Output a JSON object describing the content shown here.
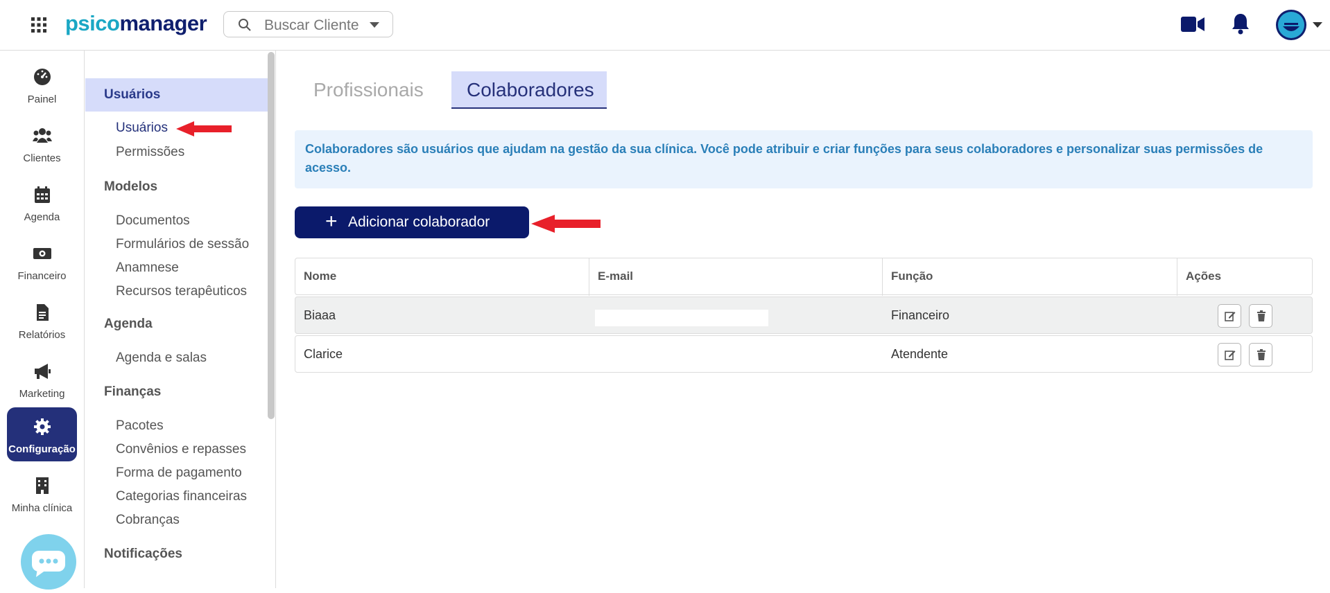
{
  "topbar": {
    "logo_part1": "psico",
    "logo_part2": "manager",
    "search_placeholder": "Buscar Cliente",
    "icons": [
      "apps-grid-icon",
      "search-icon",
      "video-call-icon",
      "bell-icon",
      "avatar"
    ]
  },
  "rail": {
    "items": [
      {
        "label": "Painel",
        "icon": "dashboard-icon"
      },
      {
        "label": "Clientes",
        "icon": "users-icon"
      },
      {
        "label": "Agenda",
        "icon": "calendar-icon"
      },
      {
        "label": "Financeiro",
        "icon": "money-icon"
      },
      {
        "label": "Relatórios",
        "icon": "report-icon"
      },
      {
        "label": "Marketing",
        "icon": "megaphone-icon"
      },
      {
        "label": "Configuração",
        "icon": "gear-icon",
        "active": true
      },
      {
        "label": "Minha clínica",
        "icon": "building-icon"
      }
    ]
  },
  "submenu": {
    "sections": [
      {
        "title": "Usuários",
        "items": [
          "Usuários",
          "Permissões"
        ]
      },
      {
        "title": "Modelos",
        "items": [
          "Documentos",
          "Formulários de sessão",
          "Anamnese",
          "Recursos terapêuticos"
        ]
      },
      {
        "title": "Agenda",
        "items": [
          "Agenda e salas"
        ]
      },
      {
        "title": "Finanças",
        "items": [
          "Pacotes",
          "Convênios e repasses",
          "Forma de pagamento",
          "Categorias financeiras",
          "Cobranças"
        ]
      },
      {
        "title": "Notificações",
        "items": []
      }
    ]
  },
  "tabs": {
    "inactive": "Profissionais",
    "active": "Colaboradores"
  },
  "info_text": "Colaboradores são usuários que ajudam na gestão da sua clínica. Você pode atribuir e criar funções para seus colaboradores e personalizar suas permissões de acesso.",
  "add_button": "Adicionar colaborador",
  "table": {
    "headers": [
      "Nome",
      "E-mail",
      "Função",
      "Ações"
    ],
    "rows": [
      {
        "nome": "Biaaa",
        "email": "",
        "funcao": "Financeiro"
      },
      {
        "nome": "Clarice",
        "email": "",
        "funcao": "Atendente"
      }
    ]
  },
  "colors": {
    "brand_dark": "#0b1a6b",
    "brand_cyan": "#1aa7c4",
    "active_bg": "#d6dcfa",
    "info_text": "#2a7fb8",
    "arrow": "#e8202a"
  }
}
